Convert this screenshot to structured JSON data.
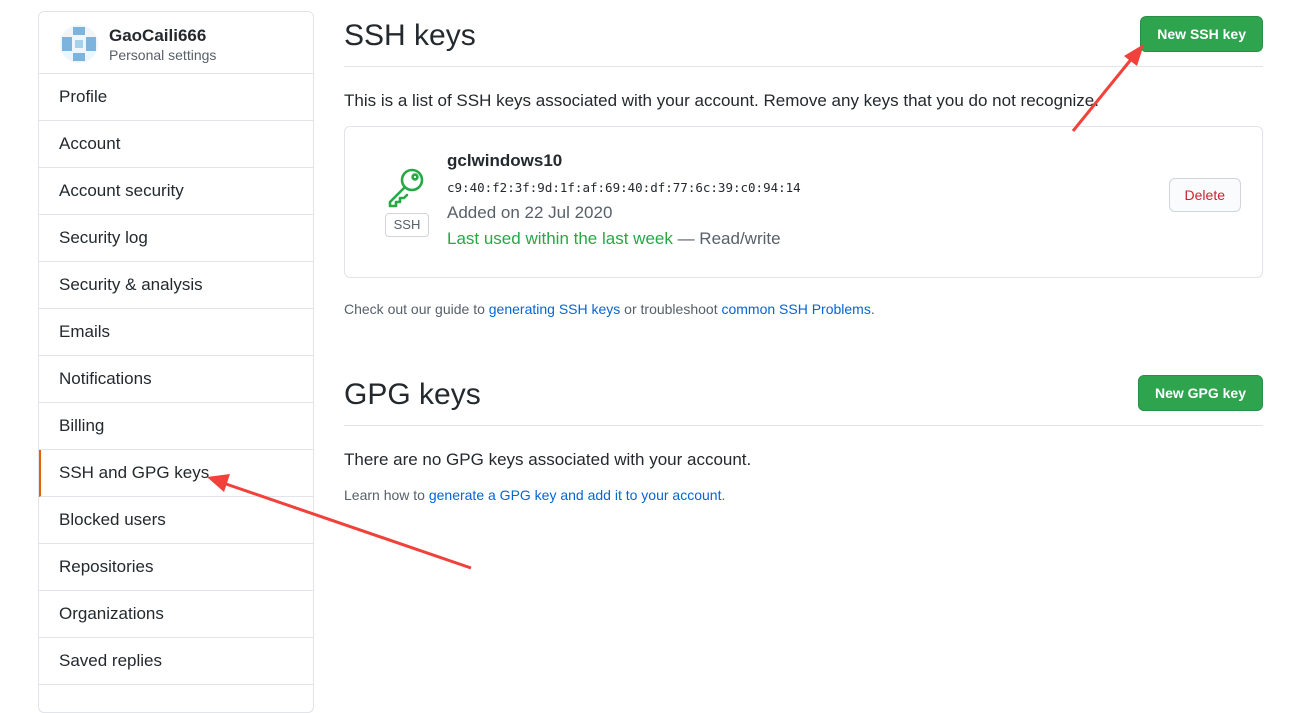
{
  "user": {
    "name": "GaoCaili666",
    "subtitle": "Personal settings"
  },
  "sidebar": {
    "items": [
      {
        "label": "Profile",
        "id": "profile"
      },
      {
        "label": "Account",
        "id": "account"
      },
      {
        "label": "Account security",
        "id": "account-security"
      },
      {
        "label": "Security log",
        "id": "security-log"
      },
      {
        "label": "Security & analysis",
        "id": "security-analysis"
      },
      {
        "label": "Emails",
        "id": "emails"
      },
      {
        "label": "Notifications",
        "id": "notifications"
      },
      {
        "label": "Billing",
        "id": "billing"
      },
      {
        "label": "SSH and GPG keys",
        "id": "ssh-gpg-keys",
        "selected": true
      },
      {
        "label": "Blocked users",
        "id": "blocked-users"
      },
      {
        "label": "Repositories",
        "id": "repositories"
      },
      {
        "label": "Organizations",
        "id": "organizations"
      },
      {
        "label": "Saved replies",
        "id": "saved-replies"
      }
    ]
  },
  "ssh": {
    "title": "SSH keys",
    "new_button": "New SSH key",
    "intro": "This is a list of SSH keys associated with your account. Remove any keys that you do not recognize.",
    "key": {
      "name": "gclwindows10",
      "badge": "SSH",
      "fingerprint": "c9:40:f2:3f:9d:1f:af:69:40:df:77:6c:39:c0:94:14",
      "added": "Added on 22 Jul 2020",
      "last_used": "Last used within the last week",
      "access": " — Read/write",
      "delete_label": "Delete"
    },
    "guide": {
      "prefix": "Check out our guide to ",
      "link1": "generating SSH keys",
      "middle": " or troubleshoot ",
      "link2": "common SSH Problems",
      "suffix": "."
    }
  },
  "gpg": {
    "title": "GPG keys",
    "new_button": "New GPG key",
    "empty": "There are no GPG keys associated with your account.",
    "learn_prefix": "Learn how to ",
    "learn_link": "generate a GPG key and add it to your account",
    "learn_suffix": "."
  },
  "colors": {
    "accent_green": "#2ea44f",
    "selected_indicator": "#e36209",
    "link": "#0366d6",
    "danger": "#cb2431",
    "annotation_arrow": "#f0413a"
  }
}
